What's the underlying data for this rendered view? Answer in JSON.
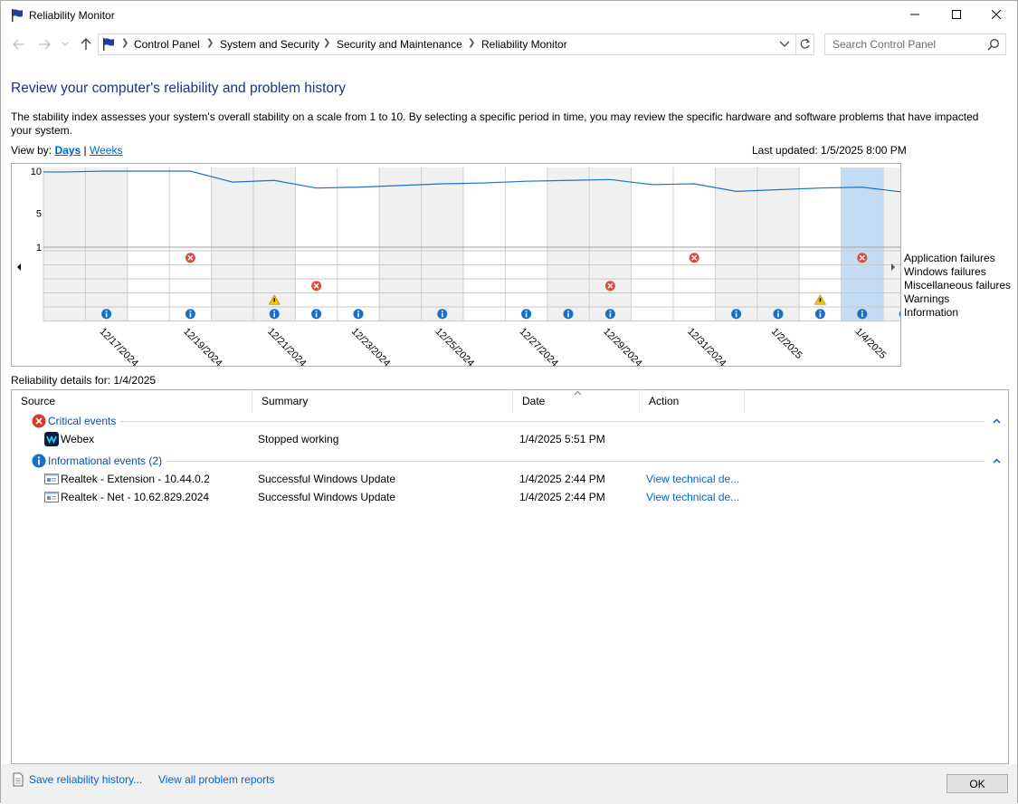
{
  "window": {
    "title": "Reliability Monitor"
  },
  "address": {
    "crumbs": [
      "Control Panel",
      "System and Security",
      "Security and Maintenance",
      "Reliability Monitor"
    ]
  },
  "search": {
    "placeholder": "Search Control Panel"
  },
  "content": {
    "heading": "Review your computer's reliability and problem history",
    "description": "The stability index assesses your system's overall stability on a scale from 1 to 10. By selecting a specific period in time, you may review the specific hardware and software problems that have impacted your system.",
    "view_by_label": "View by:",
    "view_days": "Days",
    "view_sep": "|",
    "view_weeks": "Weeks",
    "last_updated": "Last updated: 1/5/2025 8:00 PM",
    "details_for": "Reliability details for: 1/4/2025"
  },
  "legend": [
    "Application failures",
    "Windows failures",
    "Miscellaneous failures",
    "Warnings",
    "Information"
  ],
  "chart_data": {
    "type": "line",
    "title": "",
    "ylim": [
      1,
      10
    ],
    "y_ticks": [
      "10",
      "5",
      "1"
    ],
    "date_labels": [
      "12/17/2024",
      "12/19/2024",
      "12/21/2024",
      "12/23/2024",
      "12/25/2024",
      "12/27/2024",
      "12/29/2024",
      "12/31/2024",
      "1/2/2025",
      "1/4/2025"
    ],
    "days": [
      "12/16/2024",
      "12/17/2024",
      "12/18/2024",
      "12/19/2024",
      "12/20/2024",
      "12/21/2024",
      "12/22/2024",
      "12/23/2024",
      "12/24/2024",
      "12/25/2024",
      "12/26/2024",
      "12/27/2024",
      "12/28/2024",
      "12/29/2024",
      "12/30/2024",
      "12/31/2024",
      "1/1/2025",
      "1/2/2025",
      "1/3/2025",
      "1/4/2025",
      "1/5/2025"
    ],
    "stability_index": [
      9.9,
      10.0,
      10.0,
      10.0,
      8.7,
      8.9,
      8.0,
      8.1,
      8.3,
      8.5,
      8.6,
      8.8,
      8.9,
      9.0,
      8.4,
      8.5,
      7.6,
      7.8,
      8.0,
      8.1,
      7.5
    ],
    "selected_day": "1/4/2025",
    "events": {
      "application_failures": [
        "12/19/2024",
        "12/31/2024",
        "1/4/2025"
      ],
      "windows_failures": [],
      "miscellaneous_failures": [
        "12/22/2024",
        "12/29/2024"
      ],
      "warnings": [
        "12/21/2024",
        "1/3/2025"
      ],
      "information": [
        "12/17/2024",
        "12/19/2024",
        "12/21/2024",
        "12/22/2024",
        "12/23/2024",
        "12/25/2024",
        "12/27/2024",
        "12/28/2024",
        "12/29/2024",
        "1/1/2025",
        "1/2/2025",
        "1/3/2025",
        "1/4/2025",
        "1/5/2025"
      ]
    }
  },
  "grid": {
    "columns": [
      "Source",
      "Summary",
      "Date",
      "Action"
    ],
    "groups": [
      {
        "label": "Critical events",
        "rows": [
          {
            "source": "Webex",
            "summary": "Stopped working",
            "date": "1/4/2025 5:51 PM",
            "action": ""
          }
        ]
      },
      {
        "label": "Informational events (2)",
        "rows": [
          {
            "source": "Realtek - Extension - 10.44.0.2",
            "summary": "Successful Windows Update",
            "date": "1/4/2025 2:44 PM",
            "action": "View technical de..."
          },
          {
            "source": "Realtek - Net - 10.62.829.2024",
            "summary": "Successful Windows Update",
            "date": "1/4/2025 2:44 PM",
            "action": "View technical de..."
          }
        ]
      }
    ]
  },
  "footer": {
    "save_history": "Save reliability history...",
    "view_reports": "View all problem reports",
    "ok": "OK"
  },
  "colors": {
    "accent": "#1e3287",
    "link": "#0066cc",
    "error": "#e04a3a",
    "info": "#1670c9",
    "warning": "#f5c400",
    "selected": "#c3dcf3",
    "line": "#1a73c8"
  }
}
